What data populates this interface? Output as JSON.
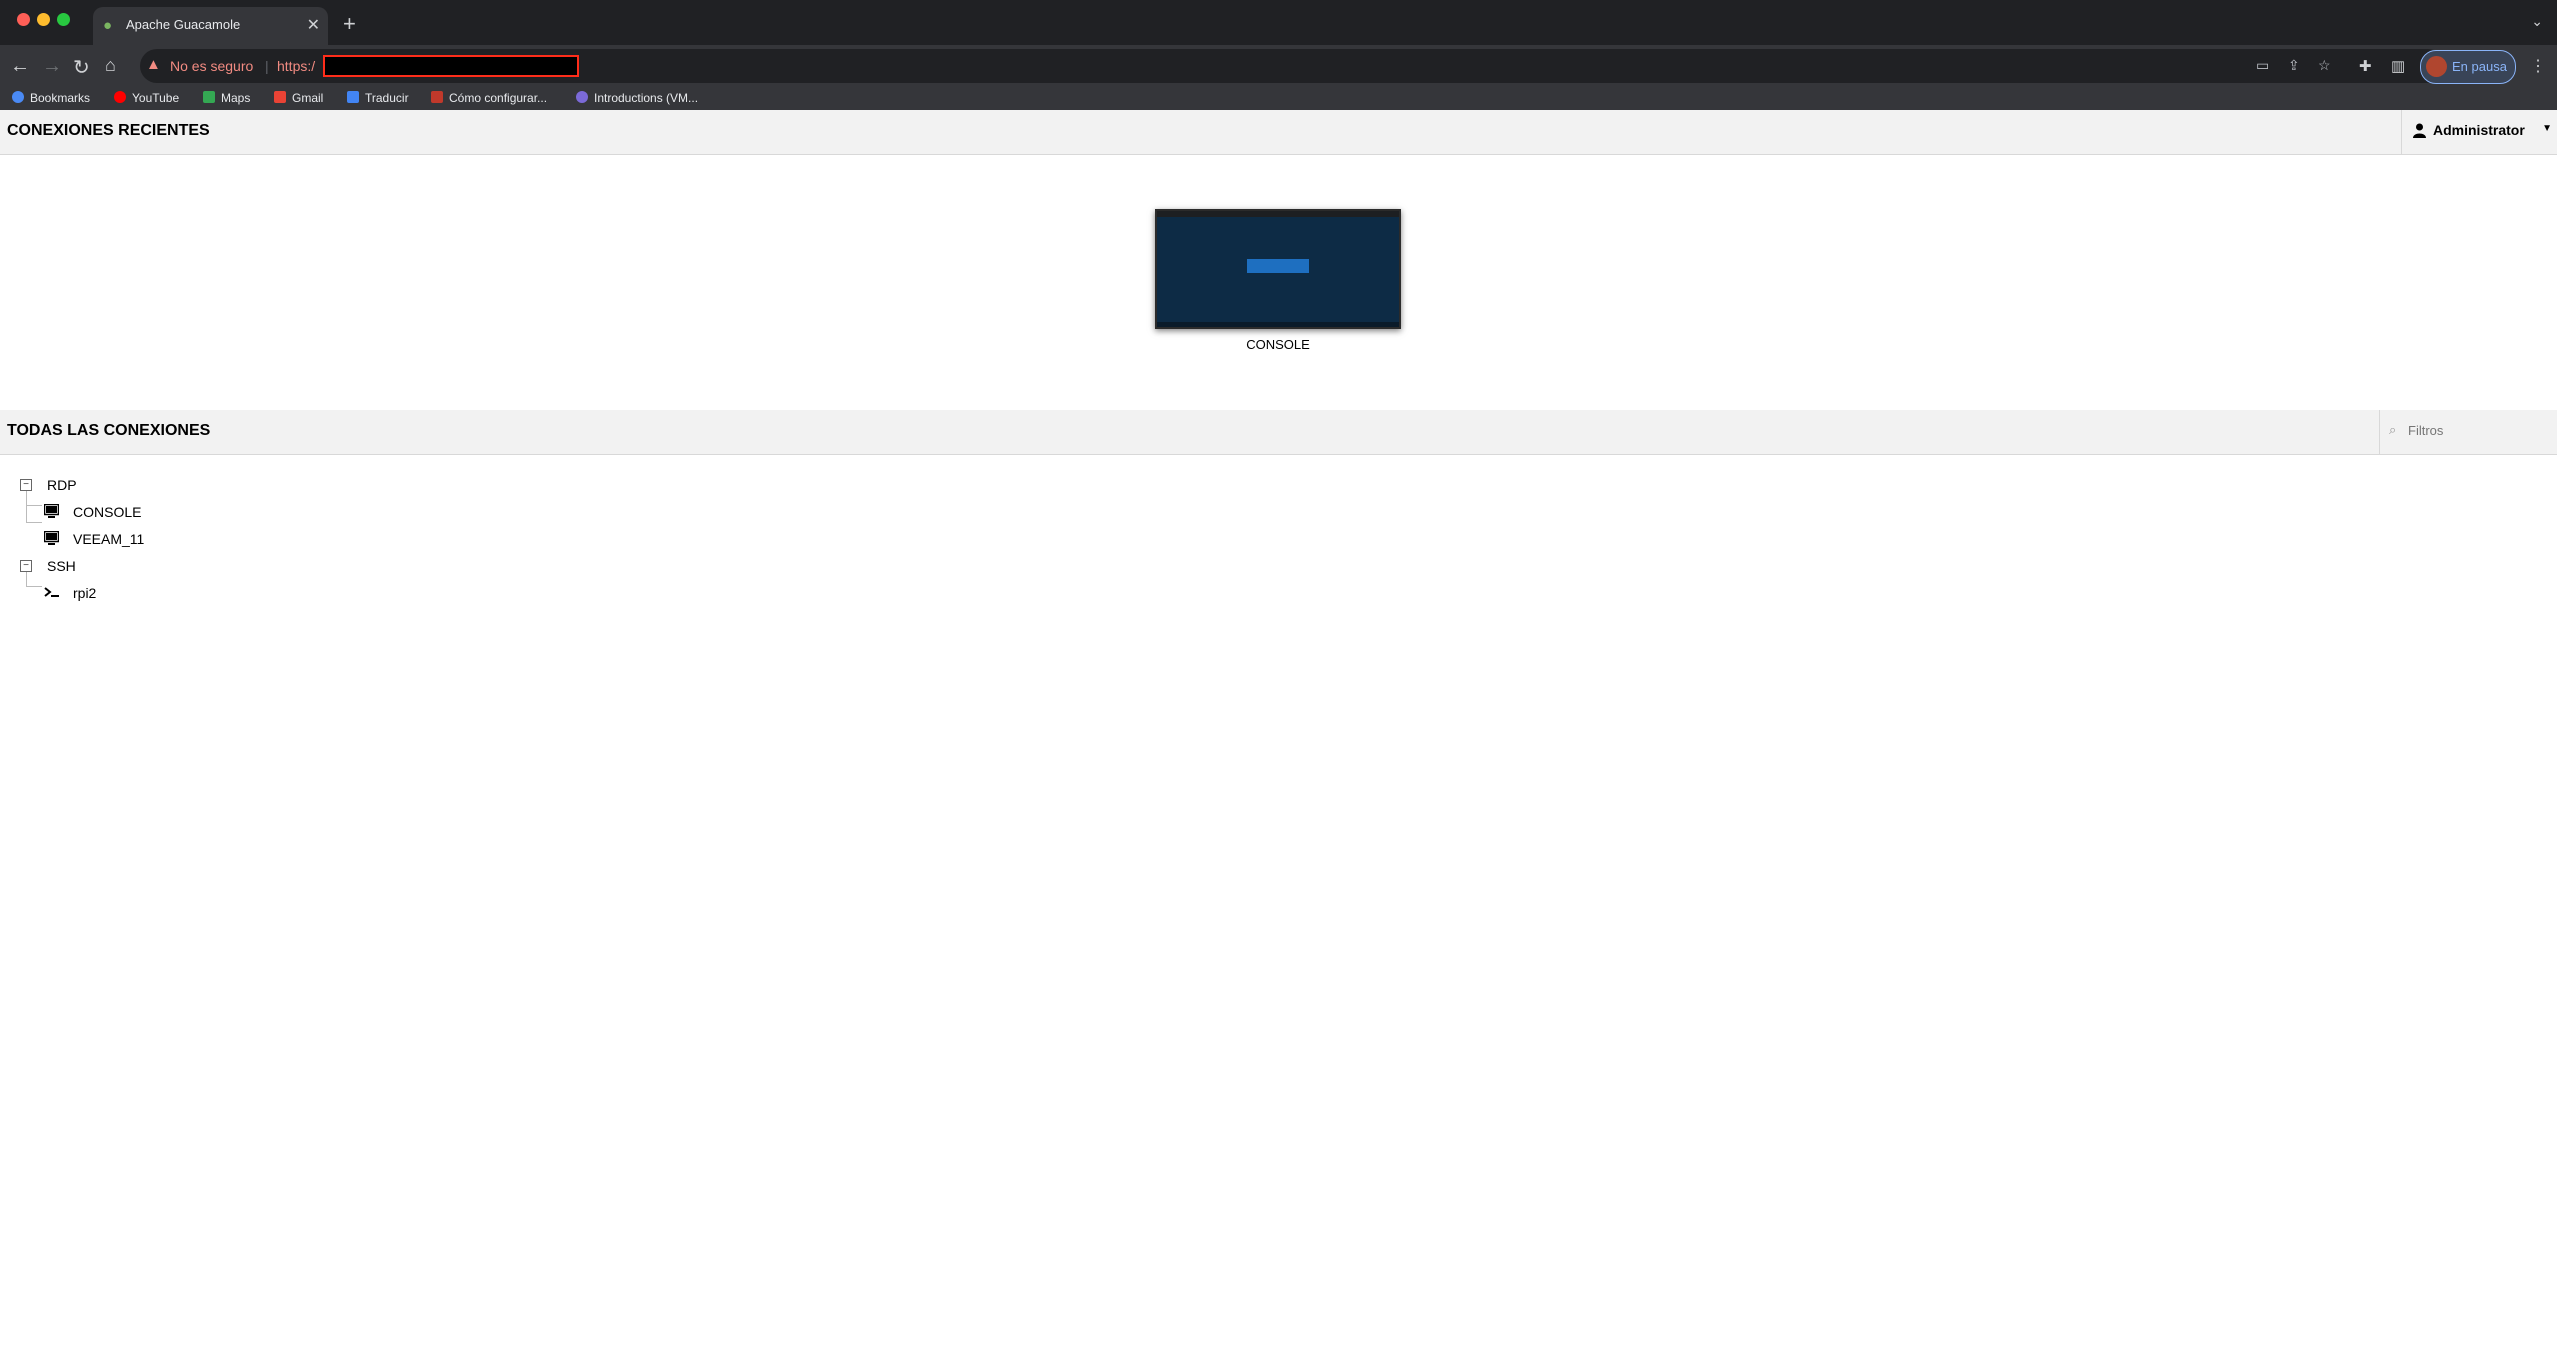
{
  "browser": {
    "tab_title": "Apache Guacamole",
    "tab_close": "✕",
    "new_tab": "+",
    "security_warning": "No es seguro",
    "url_prefix": "https:/",
    "profile_label": "En pausa",
    "bookmarks": [
      {
        "label": "Bookmarks",
        "icon": "star-icon",
        "color": "#4a8af4"
      },
      {
        "label": "YouTube",
        "icon": "youtube-icon",
        "color": "#ff0000"
      },
      {
        "label": "Maps",
        "icon": "maps-icon",
        "color": "#34a853"
      },
      {
        "label": "Gmail",
        "icon": "gmail-icon",
        "color": "#ea4335"
      },
      {
        "label": "Traducir",
        "icon": "translate-icon",
        "color": "#4285f4"
      },
      {
        "label": "Cómo configurar...",
        "icon": "az-icon",
        "color": "#c0392b"
      },
      {
        "label": "Introductions (VM...",
        "icon": "vmware-icon",
        "color": "#7b6ad8"
      }
    ]
  },
  "app": {
    "recent_title": "CONEXIONES RECIENTES",
    "user_name": "Administrator",
    "recent_connections": [
      {
        "label": "CONSOLE"
      }
    ],
    "all_title": "TODAS LAS CONEXIONES",
    "filter_placeholder": "Filtros",
    "tree": {
      "groups": [
        {
          "name": "RDP",
          "expander": "−",
          "connections": [
            {
              "name": "CONSOLE",
              "icon": "monitor-icon"
            },
            {
              "name": "VEEAM_11",
              "icon": "monitor-icon"
            }
          ]
        },
        {
          "name": "SSH",
          "expander": "−",
          "connections": [
            {
              "name": "rpi2",
              "icon": "terminal-icon"
            }
          ]
        }
      ]
    }
  }
}
